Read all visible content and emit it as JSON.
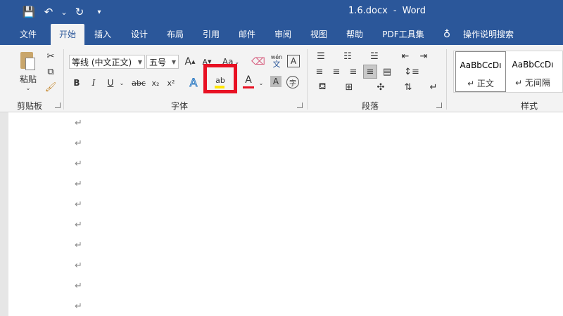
{
  "window": {
    "file_name": "1.6.docx",
    "separator": "-",
    "app_name": "Word"
  },
  "qat": {
    "save": "💾",
    "undo": "↶",
    "undo_more": "⌄",
    "redo": "↻",
    "customize": "₹"
  },
  "tabs": [
    "文件",
    "开始",
    "插入",
    "设计",
    "布局",
    "引用",
    "邮件",
    "审阅",
    "视图",
    "帮助",
    "PDF工具集",
    "操作说明搜索"
  ],
  "active_tab": "开始",
  "clipboard": {
    "paste_label": "粘贴",
    "group_label": "剪贴板"
  },
  "font": {
    "font_name": "等线 (中文正文)",
    "font_size": "五号",
    "grow": "A",
    "shrink": "A",
    "case": "Aa",
    "wen": "wén",
    "wen_char": "文",
    "boxed_a": "A",
    "bold": "B",
    "italic": "I",
    "underline": "U",
    "strike": "abc",
    "subscript": "x₂",
    "superscript": "x²",
    "effects": "A",
    "highlight": "ab",
    "font_color": "A",
    "shade": "A",
    "enclose": "字",
    "group_label": "字体"
  },
  "paragraph": {
    "group_label": "段落"
  },
  "styles": {
    "items": [
      {
        "sample": "AaBbCcDı",
        "name": "↵ 正文"
      },
      {
        "sample": "AaBbCcDı",
        "name": "↵ 无间隔"
      }
    ],
    "group_label": "样式"
  },
  "document": {
    "paragraph_mark": "↵",
    "paragraph_count": 10
  },
  "colors": {
    "title_blue": "#2b579a",
    "highlight_callout": "#e81123",
    "highlight_yellow": "#ffe600",
    "font_color_red": "#e81123"
  }
}
